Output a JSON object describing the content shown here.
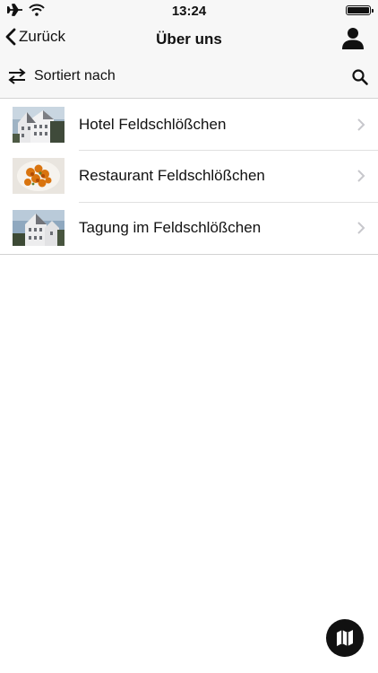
{
  "status_bar": {
    "time": "13:24",
    "icons": [
      "airplane-icon",
      "wifi-icon",
      "battery-icon"
    ]
  },
  "nav": {
    "back_label": "Zurück",
    "title": "Über uns",
    "icons": [
      "chevron-left-icon",
      "user-icon"
    ]
  },
  "sort": {
    "label": "Sortiert nach",
    "icons": [
      "swap-arrows-icon",
      "search-icon"
    ]
  },
  "items": [
    {
      "label": "Hotel Feldschlößchen",
      "thumbnail": "hotel-building-photo"
    },
    {
      "label": "Restaurant Feldschlößchen",
      "thumbnail": "food-plate-photo"
    },
    {
      "label": "Tagung im Feldschlößchen",
      "thumbnail": "building-photo"
    }
  ],
  "map_button": {
    "icon": "map-icon"
  },
  "colors": {
    "bar_background": "#f7f7f7",
    "text": "#111111",
    "separator": "#d3d3d3",
    "chevron": "#c7c7cc"
  }
}
